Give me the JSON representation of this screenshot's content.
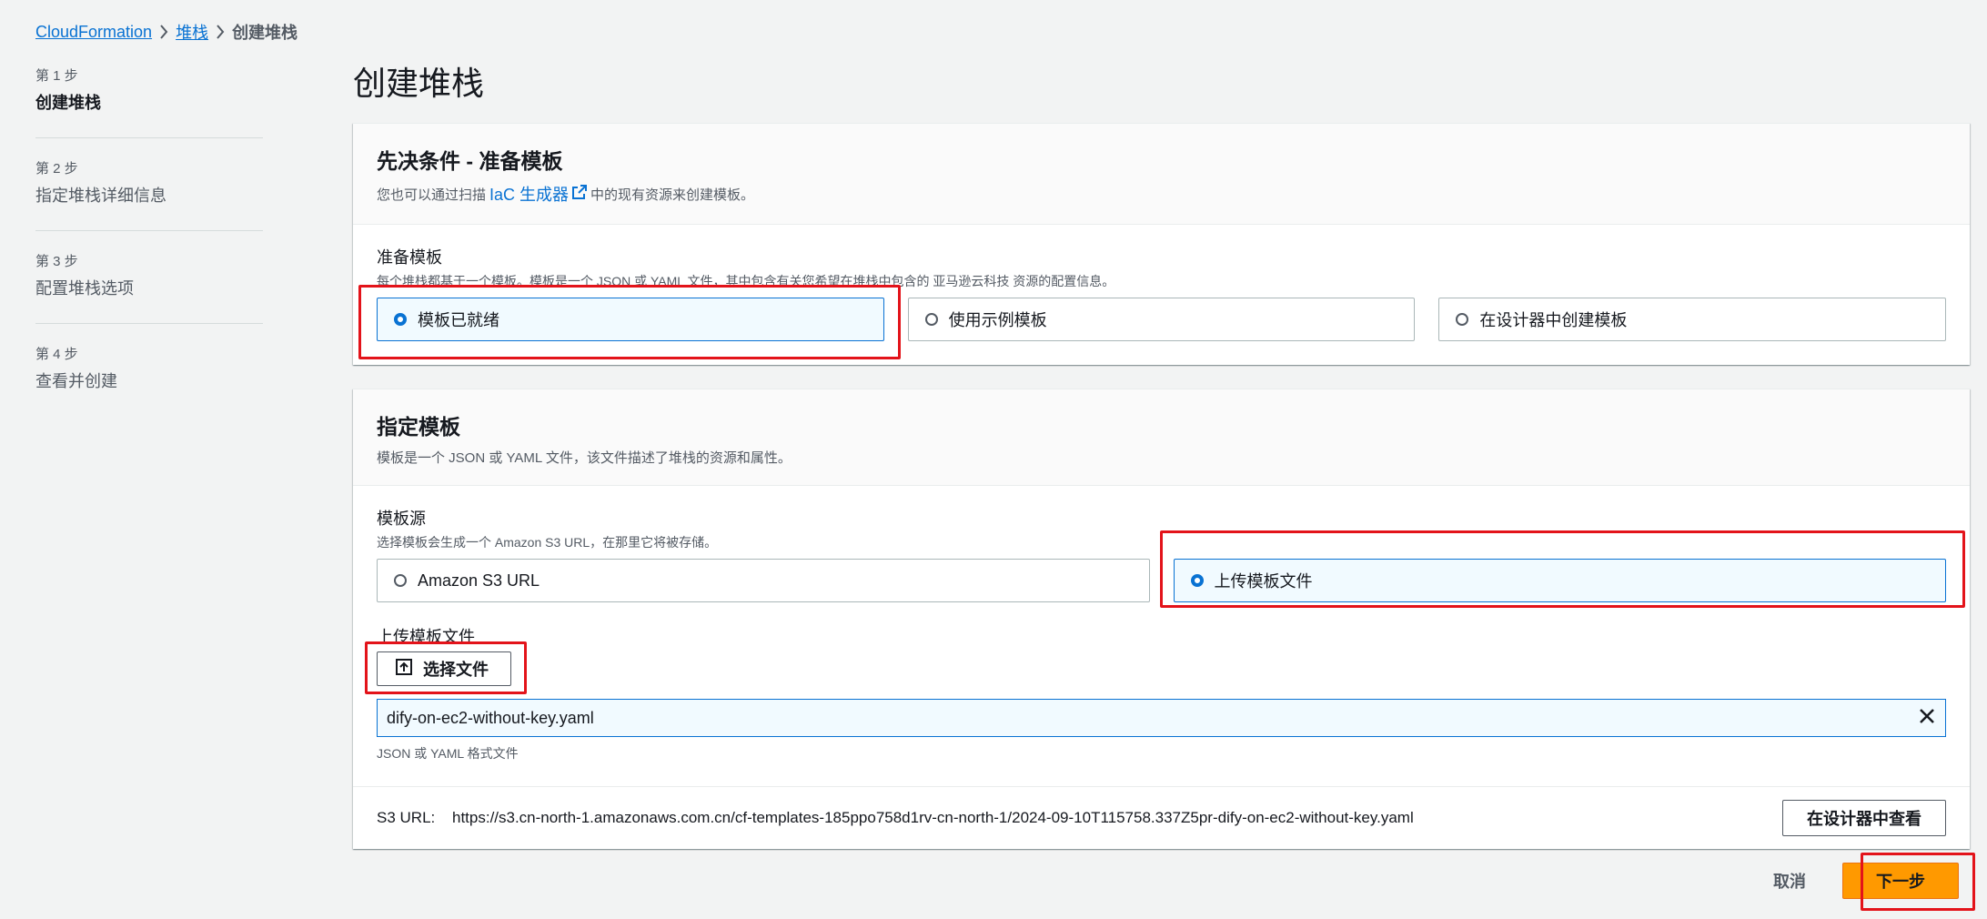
{
  "breadcrumb": {
    "root": "CloudFormation",
    "parent": "堆栈",
    "current": "创建堆栈"
  },
  "steps": [
    {
      "num": "第 1 步",
      "title": "创建堆栈"
    },
    {
      "num": "第 2 步",
      "title": "指定堆栈详细信息"
    },
    {
      "num": "第 3 步",
      "title": "配置堆栈选项"
    },
    {
      "num": "第 4 步",
      "title": "查看并创建"
    }
  ],
  "page_title": "创建堆栈",
  "prereq": {
    "title": "先决条件 - 准备模板",
    "desc_before": "您也可以通过扫描",
    "iac_link": "IaC 生成器",
    "desc_after": "中的现有资源来创建模板。",
    "field_label": "准备模板",
    "field_desc": "每个堆栈都基于一个模板。模板是一个 JSON 或 YAML 文件，其中包含有关您希望在堆栈中包含的 亚马逊云科技 资源的配置信息。",
    "options": [
      "模板已就绪",
      "使用示例模板",
      "在设计器中创建模板"
    ]
  },
  "spec": {
    "title": "指定模板",
    "desc": "模板是一个 JSON 或 YAML 文件，该文件描述了堆栈的资源和属性。",
    "source_label": "模板源",
    "source_desc": "选择模板会生成一个 Amazon S3 URL，在那里它将被存储。",
    "source_options": [
      "Amazon S3 URL",
      "上传模板文件"
    ],
    "upload_label": "上传模板文件",
    "choose_file": "选择文件",
    "file_name": "dify-on-ec2-without-key.yaml",
    "file_hint": "JSON 或 YAML 格式文件",
    "s3_label": "S3 URL:",
    "s3_url": "https://s3.cn-north-1.amazonaws.com.cn/cf-templates-185ppo758d1rv-cn-north-1/2024-09-10T115758.337Z5pr-dify-on-ec2-without-key.yaml",
    "view_designer": "在设计器中查看"
  },
  "footer": {
    "cancel": "取消",
    "next": "下一步"
  },
  "colors": {
    "accent": "#0972d3",
    "primary": "#ff9900",
    "highlight": "#e3131a"
  }
}
